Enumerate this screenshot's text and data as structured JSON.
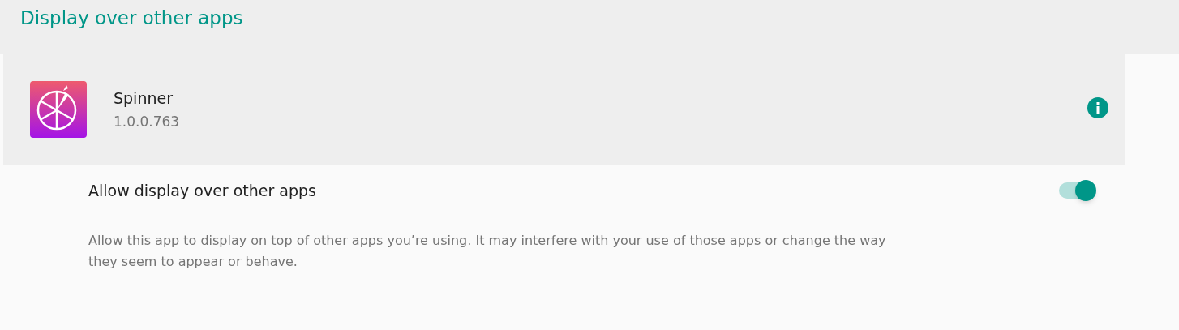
{
  "header": {
    "title": "Display over other apps"
  },
  "app": {
    "name": "Spinner",
    "version": "1.0.0.763"
  },
  "setting": {
    "label": "Allow display over other apps",
    "on": true,
    "description": "Allow this app to display on top of other apps you’re using. It may interfere with your use of those apps or change the way they seem to appear or behave."
  }
}
